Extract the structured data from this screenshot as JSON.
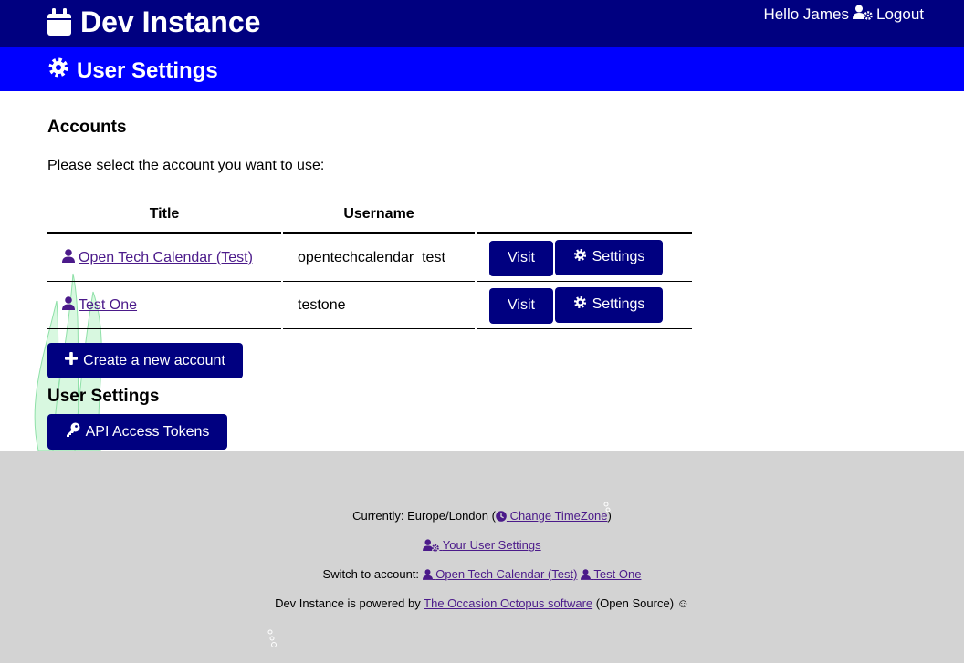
{
  "header": {
    "site_title": "Dev Instance",
    "greeting": "Hello James",
    "logout_label": "Logout"
  },
  "subheader": {
    "title": "User Settings"
  },
  "accounts": {
    "heading": "Accounts",
    "intro": "Please select the account you want to use:",
    "columns": [
      "Title",
      "Username"
    ],
    "rows": [
      {
        "title": "Open Tech Calendar (Test)",
        "username": "opentechcalendar_test",
        "visit_label": "Visit",
        "settings_label": "Settings"
      },
      {
        "title": "Test One",
        "username": "testone",
        "visit_label": "Visit",
        "settings_label": "Settings"
      }
    ],
    "create_label": "Create a new account"
  },
  "user_settings": {
    "heading": "User Settings",
    "api_tokens_label": "API Access Tokens"
  },
  "footer": {
    "timezone_prefix": "Currently: Europe/London (",
    "timezone_link": "Change TimeZone",
    "timezone_suffix": ")",
    "user_settings_link": "Your User Settings",
    "switch_prefix": "Switch to account:",
    "switch_accounts": [
      "Open Tech Calendar (Test)",
      "Test One"
    ],
    "powered_prefix": "Dev Instance is powered by",
    "powered_link": "The Occasion Octopus software",
    "powered_suffix": "(Open Source) ☺"
  },
  "colors": {
    "header_bg": "#000080",
    "subheader_bg": "#0000ff",
    "button_bg": "#000080",
    "link": "#4b1a8a",
    "footer_bg": "#d3d3d3"
  },
  "icons": [
    "calendar-icon",
    "user-gear-icon",
    "gear-icon",
    "user-icon",
    "plus-icon",
    "key-icon",
    "clock-icon"
  ]
}
